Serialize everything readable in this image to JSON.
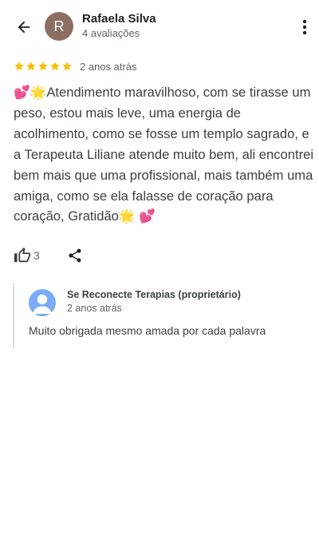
{
  "header": {
    "avatar_letter": "R",
    "author_name": "Rafaela Silva",
    "author_meta": "4 avaliações",
    "back_icon": "arrow-left-icon",
    "more_icon": "more-vert-icon",
    "avatar_color": "#8d6e63"
  },
  "review": {
    "rating": 5,
    "rating_max": 5,
    "star_color": "#fbbc04",
    "date": "2 anos atrás",
    "text": "💕🌟Atendimento maravilhoso, com se tirasse um peso, estou mais leve, uma energia de acolhimento, como se fosse um templo sagrado, e a Terapeuta Liliane atende muito bem, ali encontrei bem mais que uma profissional, mais também uma amiga, como se ela falasse de coração para coração, Gratidão🌟 💕"
  },
  "actions": {
    "like_icon": "thumb-up-icon",
    "like_count": "3",
    "share_icon": "share-icon"
  },
  "owner_reply": {
    "avatar_icon": "person-icon",
    "avatar_color": "#7baaf7",
    "name": "Se Reconecte Terapias (proprietário)",
    "date": "2 anos atrás",
    "text": "Muito obrigada mesmo amada por cada palavra"
  }
}
